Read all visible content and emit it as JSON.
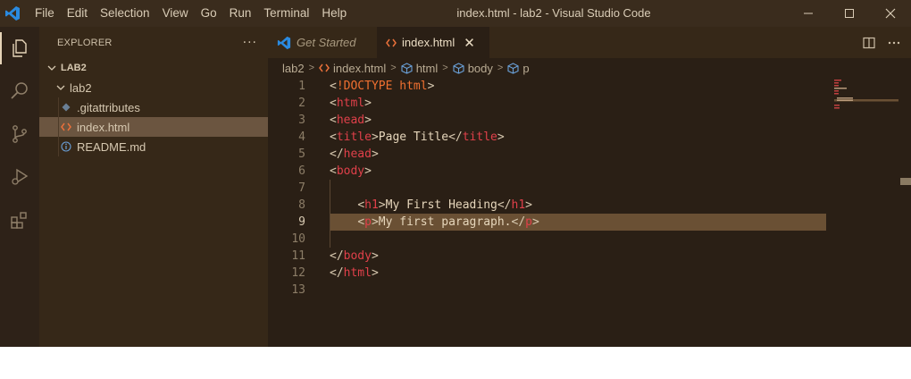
{
  "window": {
    "title": "index.html - lab2 - Visual Studio Code",
    "menu": [
      "File",
      "Edit",
      "Selection",
      "View",
      "Go",
      "Run",
      "Terminal",
      "Help"
    ]
  },
  "sidebar": {
    "title": "EXPLORER",
    "more": "···",
    "section": "LAB2",
    "folder": "lab2",
    "files": [
      ".gitattributes",
      "index.html",
      "README.md"
    ]
  },
  "tabs": [
    {
      "label": "Get Started",
      "icon": "vscode-logo-icon"
    },
    {
      "label": "index.html",
      "icon": "html-file-icon",
      "close": "✕"
    }
  ],
  "breadcrumbs": [
    "lab2",
    "index.html",
    "html",
    "body",
    "p"
  ],
  "code": {
    "line_numbers": [
      "1",
      "2",
      "3",
      "4",
      "5",
      "6",
      "7",
      "8",
      "9",
      "10",
      "11",
      "12",
      "13"
    ],
    "current_line": 9,
    "lines": [
      [
        [
          "punct",
          "<"
        ],
        [
          "doc",
          "!DOCTYPE"
        ],
        [
          "text",
          " "
        ],
        [
          "doc",
          "html"
        ],
        [
          "punct",
          ">"
        ]
      ],
      [
        [
          "punct",
          "<"
        ],
        [
          "tag",
          "html"
        ],
        [
          "punct",
          ">"
        ]
      ],
      [
        [
          "punct",
          "<"
        ],
        [
          "tag",
          "head"
        ],
        [
          "punct",
          ">"
        ]
      ],
      [
        [
          "punct",
          "<"
        ],
        [
          "tag",
          "title"
        ],
        [
          "punct",
          ">"
        ],
        [
          "text",
          "Page Title"
        ],
        [
          "punct",
          "</"
        ],
        [
          "tag",
          "title"
        ],
        [
          "punct",
          ">"
        ]
      ],
      [
        [
          "punct",
          "</"
        ],
        [
          "tag",
          "head"
        ],
        [
          "punct",
          ">"
        ]
      ],
      [
        [
          "punct",
          "<"
        ],
        [
          "tag",
          "body"
        ],
        [
          "punct",
          ">"
        ]
      ],
      [],
      [
        [
          "text",
          "    "
        ],
        [
          "punct",
          "<"
        ],
        [
          "tag",
          "h1"
        ],
        [
          "punct",
          ">"
        ],
        [
          "text",
          "My First Heading"
        ],
        [
          "punct",
          "</"
        ],
        [
          "tag",
          "h1"
        ],
        [
          "punct",
          ">"
        ]
      ],
      [
        [
          "text",
          "    "
        ],
        [
          "punct",
          "<"
        ],
        [
          "tag",
          "p"
        ],
        [
          "punct",
          ">"
        ],
        [
          "text",
          "My first paragraph."
        ],
        [
          "punct",
          "</"
        ],
        [
          "tag",
          "p"
        ],
        [
          "punct",
          ">"
        ]
      ],
      [],
      [
        [
          "punct",
          "</"
        ],
        [
          "tag",
          "body"
        ],
        [
          "punct",
          ">"
        ]
      ],
      [
        [
          "punct",
          "</"
        ],
        [
          "tag",
          "html"
        ],
        [
          "punct",
          ">"
        ]
      ],
      []
    ]
  },
  "colors": {
    "accent": "#2a7fd4",
    "html_icon": "#e8703a",
    "tag": "#e0404a",
    "doctype": "#f07030"
  }
}
